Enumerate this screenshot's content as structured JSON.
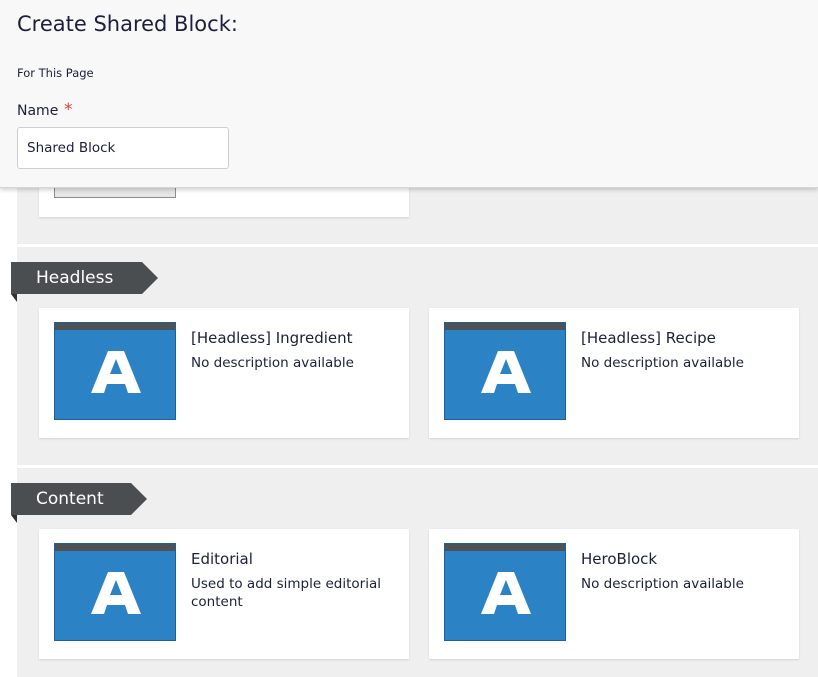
{
  "dialog": {
    "title": "Create Shared Block:",
    "scope": "For This Page",
    "name_label": "Name",
    "required_marker": "*",
    "name_value": "Shared Block"
  },
  "categories": [
    {
      "name": "Headless",
      "blocks": [
        {
          "title": "[Headless] Ingredient",
          "description": "No description available",
          "icon": "block-type-a-icon"
        },
        {
          "title": "[Headless] Recipe",
          "description": "No description available",
          "icon": "block-type-a-icon"
        }
      ]
    },
    {
      "name": "Content",
      "blocks": [
        {
          "title": "Editorial",
          "description": "Used to add simple editorial content",
          "icon": "block-type-a-icon"
        },
        {
          "title": "HeroBlock",
          "description": "No description available",
          "icon": "block-type-a-icon"
        }
      ]
    }
  ],
  "colors": {
    "thumbnail": "#2b82c4",
    "category_tag": "#4b4e51",
    "required": "#d9413a",
    "background": "#efefef"
  }
}
